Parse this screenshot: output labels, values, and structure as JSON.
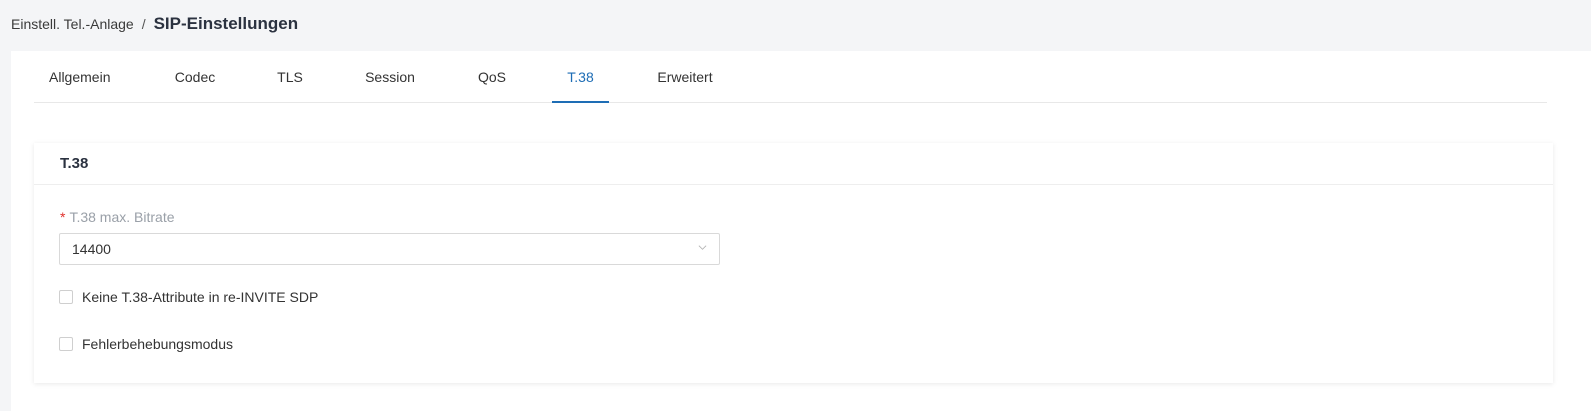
{
  "breadcrumb": {
    "parent": "Einstell. Tel.-Anlage",
    "separator": "/",
    "current": "SIP-Einstellungen"
  },
  "tabs": [
    {
      "label": "Allgemein",
      "active": false
    },
    {
      "label": "Codec",
      "active": false
    },
    {
      "label": "TLS",
      "active": false
    },
    {
      "label": "Session",
      "active": false
    },
    {
      "label": "QoS",
      "active": false
    },
    {
      "label": "T.38",
      "active": true
    },
    {
      "label": "Erweitert",
      "active": false
    }
  ],
  "card": {
    "title": "T.38",
    "bitrate": {
      "required_mark": "*",
      "label": "T.38 max. Bitrate",
      "value": "14400",
      "icon": "chevron-down-icon"
    },
    "options": [
      {
        "label": "Keine T.38-Attribute in re-INVITE SDP",
        "checked": false
      },
      {
        "label": "Fehlerbehebungsmodus",
        "checked": false
      }
    ]
  },
  "colors": {
    "accent": "#1e6db5",
    "required": "#e0302c",
    "page_background": "#f4f5f7"
  }
}
